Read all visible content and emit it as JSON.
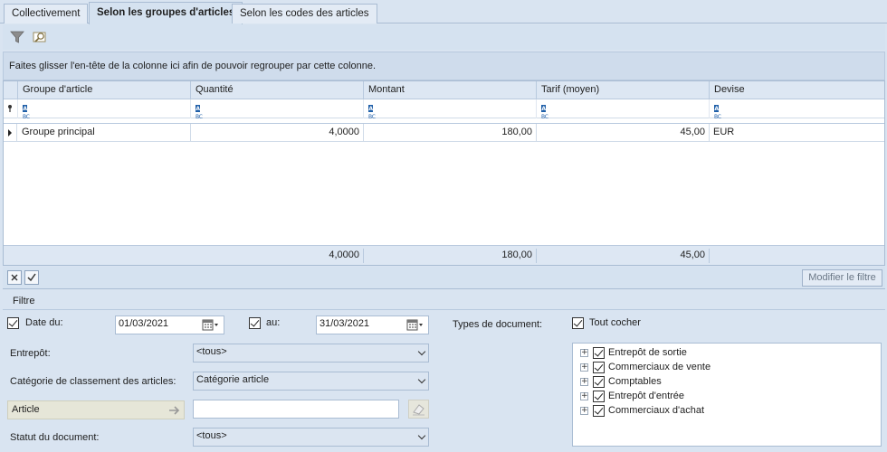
{
  "tabs": [
    "Collectivement",
    "Selon les groupes d'articles",
    "Selon les codes des articles"
  ],
  "group_panel_text": "Faites glisser l'en-tête de la colonne ici afin de pouvoir regrouper par cette colonne.",
  "grid": {
    "columns": [
      "Groupe d'article",
      "Quantité",
      "Montant",
      "Tarif (moyen)",
      "Devise"
    ],
    "filter_icon_text": "ABC",
    "rows": [
      {
        "group": "Groupe principal",
        "quantity": "4,0000",
        "amount": "180,00",
        "price": "45,00",
        "currency": "EUR"
      }
    ],
    "totals": {
      "quantity": "4,0000",
      "amount": "180,00",
      "price": "45,00"
    }
  },
  "modify_filter_label": "Modifier le filtre",
  "filter": {
    "section_title": "Filtre",
    "date_from_label": "Date du:",
    "date_from_value": "01/03/2021",
    "date_to_label": "au:",
    "date_to_value": "31/03/2021",
    "doc_types_label": "Types de document:",
    "check_all_label": "Tout cocher",
    "warehouse_label": "Entrepôt:",
    "warehouse_value": "<tous>",
    "category_label": "Catégorie de classement des articles:",
    "category_value": "Catégorie article",
    "article_label": "Article",
    "article_value": "",
    "status_label": "Statut du document:",
    "status_value": "<tous>",
    "doc_types": [
      "Entrepôt de sortie",
      "Commerciaux de vente",
      "Comptables",
      "Entrepôt d'entrée",
      "Commerciaux d'achat"
    ]
  }
}
